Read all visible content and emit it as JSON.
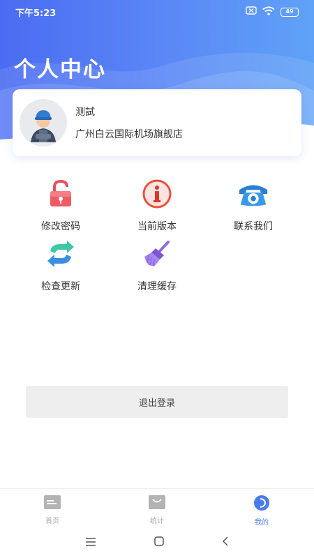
{
  "status_bar": {
    "time": "下午5:23",
    "battery_level": "49",
    "icons": [
      "sim-off-icon",
      "wifi-icon",
      "battery-icon"
    ]
  },
  "header": {
    "title": "个人中心"
  },
  "profile": {
    "user_name": "测試",
    "store_name": "广州白云国际机场旗舰店"
  },
  "menu": {
    "items": [
      {
        "label": "修改密码",
        "icon": "lock-icon"
      },
      {
        "label": "当前版本",
        "icon": "info-icon"
      },
      {
        "label": "联系我们",
        "icon": "phone-icon"
      },
      {
        "label": "检查更新",
        "icon": "refresh-icon"
      },
      {
        "label": "清理缓存",
        "icon": "broom-icon"
      }
    ]
  },
  "logout": {
    "label": "退出登录"
  },
  "tab_bar": {
    "tabs": [
      {
        "label": "首页",
        "icon": "home-icon",
        "active": false
      },
      {
        "label": "统计",
        "icon": "stats-icon",
        "active": false
      },
      {
        "label": "我的",
        "icon": "profile-icon",
        "active": true
      }
    ]
  },
  "colors": {
    "header_gradient_start": "#4a6cf2",
    "header_gradient_end": "#5fa2f7",
    "active_tab": "#4a7cf0",
    "inactive_tab": "#aaaaaa"
  }
}
